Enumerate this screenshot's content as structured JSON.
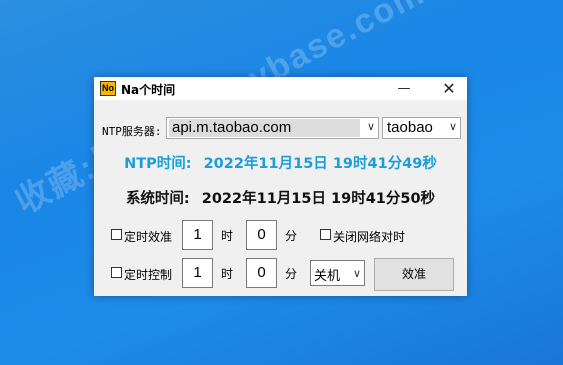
{
  "watermark": "收藏:黑域基地 hybase.com",
  "window": {
    "title": "Na个时间",
    "icon_text": "No",
    "controls": {
      "minimize": "—",
      "close": "✕"
    }
  },
  "server": {
    "label": "NTP服务器:",
    "value": "api.m.taobao.com",
    "region": "taobao"
  },
  "ntp_time": {
    "label": "NTP时间:",
    "value": "2022年11月15日 19时41分49秒"
  },
  "system_time": {
    "label": "系统时间:",
    "value": "2022年11月15日 19时41分50秒"
  },
  "timed_sync": {
    "label": "定时效准",
    "hour": "1",
    "hour_unit": "时",
    "minute": "0",
    "minute_unit": "分",
    "checked": false
  },
  "disable_network_sync": {
    "label": "关闭网络对时",
    "checked": false
  },
  "timed_control": {
    "label": "定时控制",
    "hour": "1",
    "hour_unit": "时",
    "minute": "0",
    "minute_unit": "分",
    "checked": false,
    "action": "关机"
  },
  "calibrate_button": "效准",
  "icons": {
    "dropdown": "chevron-down-icon",
    "app": "app-icon"
  },
  "colors": {
    "ntp_accent": "#1b9ed8",
    "app_icon": "#f7b500"
  }
}
